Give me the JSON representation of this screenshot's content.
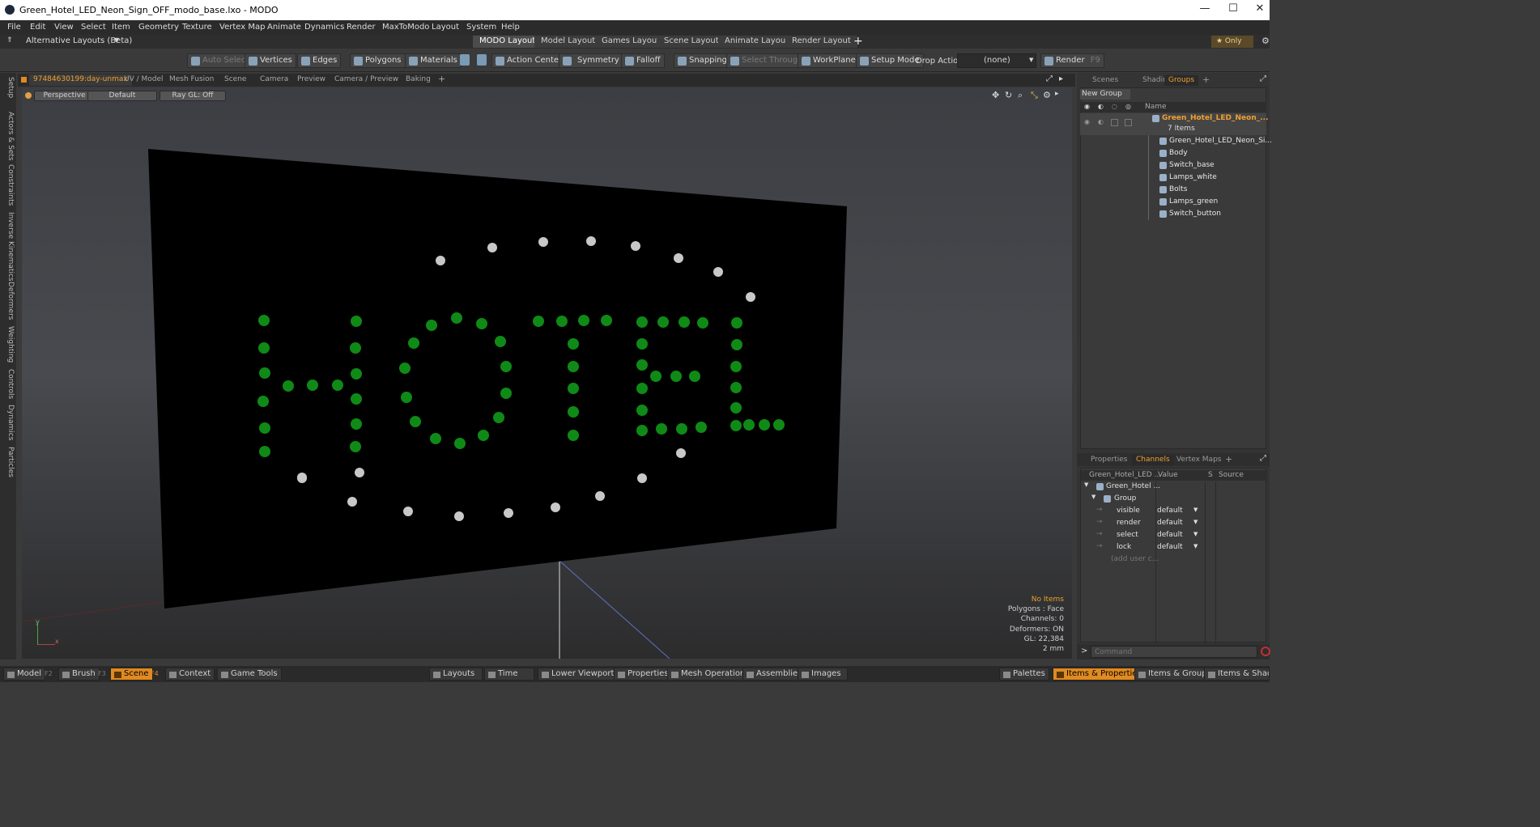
{
  "window": {
    "title": "Green_Hotel_LED_Neon_Sign_OFF_modo_base.lxo - MODO",
    "minimize": "—",
    "maximize": "☐",
    "close": "✕"
  },
  "menu": [
    "File",
    "Edit",
    "View",
    "Select",
    "Item",
    "Geometry",
    "Texture",
    "Vertex Map",
    "Animate",
    "Dynamics",
    "Render",
    "MaxToModo",
    "Layout",
    "System",
    "Help"
  ],
  "layoutbar": {
    "alt_layouts": "Alternative Layouts (Beta)",
    "tabs": [
      "MODO Layout",
      "Model Layout",
      "Games Layout",
      "Scene Layout",
      "Animate Layout",
      "Render Layout"
    ],
    "active_tab": "MODO Layout",
    "add": "+",
    "only": "★ Only"
  },
  "toolbar": {
    "auto_select": "Auto Select",
    "vertices": "Vertices",
    "edges": "Edges",
    "polygons": "Polygons",
    "materials": "Materials",
    "action_center": "Action Center",
    "symmetry": "Symmetry",
    "falloff": "Falloff",
    "snapping": "Snapping",
    "select_through": "Select Through",
    "workplane": "WorkPlane",
    "setup_mode": "Setup Mode",
    "drop_action": "Drop Action",
    "drop_value": "(none)",
    "render": "Render",
    "render_key": "F9"
  },
  "left_tabs": [
    "Setup",
    "Actors & Sets",
    "Constraints",
    "Inverse Kinematics",
    "Deformers",
    "Weighting",
    "Controls",
    "Dynamics",
    "Particles"
  ],
  "viewport_tabs": [
    "97484630199:day-unmax",
    "UV / Model",
    "Mesh Fusion",
    "Scene",
    "Camera",
    "Preview",
    "Camera / Preview",
    "Baking",
    "+"
  ],
  "viewport_header": {
    "perspective": "Perspective",
    "default": "Default",
    "raygl": "Ray GL: Off"
  },
  "viewport_stats": {
    "items": "No Items",
    "polygons": "Polygons : Face",
    "channels": "Channels: 0",
    "deformers": "Deformers: ON",
    "gl": "GL: 22,384",
    "scale": "2 mm"
  },
  "scene": {
    "lamps_green_color": "#0f8a16",
    "lamps_white_color": "#c8c8c8",
    "board_color": "#000000"
  },
  "right_top_tabs": [
    "Scenes",
    "Shading",
    "Groups",
    "+"
  ],
  "right_top_active": "Groups",
  "groups_panel": {
    "new_group": "New Group",
    "name_header": "Name",
    "group_name": "Green_Hotel_LED_Neon_...",
    "item_count": "7 Items",
    "items": [
      "Green_Hotel_LED_Neon_Si...",
      "Body",
      "Switch_base",
      "Lamps_white",
      "Bolts",
      "Lamps_green",
      "Switch_button"
    ]
  },
  "right_bottom_tabs": [
    "Properties",
    "Channels",
    "Vertex Maps",
    "+"
  ],
  "right_bottom_active": "Channels",
  "channels_panel": {
    "col_name": "Green_Hotel_LED ...",
    "col_value": "Value",
    "col_s": "S",
    "col_source": "Source",
    "root": "Green_Hotel ...",
    "group": "Group",
    "rows": [
      {
        "name": "visible",
        "value": "default"
      },
      {
        "name": "render",
        "value": "default"
      },
      {
        "name": "select",
        "value": "default"
      },
      {
        "name": "lock",
        "value": "default"
      }
    ],
    "add_user": "(add user c..."
  },
  "command": {
    "placeholder": "Command"
  },
  "bottombar": {
    "model": "Model",
    "model_key": "F2",
    "brush": "Brush",
    "brush_key": "F3",
    "scene": "Scene",
    "scene_key": "F4",
    "context": "Context",
    "game_tools": "Game Tools",
    "layouts": "Layouts",
    "time": "Time",
    "lower_viewports": "Lower Viewports",
    "properties": "Properties",
    "mesh_operations": "Mesh Operations",
    "assemblies": "Assemblies",
    "images": "Images",
    "palettes": "Palettes",
    "items_properties": "Items & Properties",
    "items_groups": "Items & Groups",
    "items_shading": "Items & Shading"
  }
}
